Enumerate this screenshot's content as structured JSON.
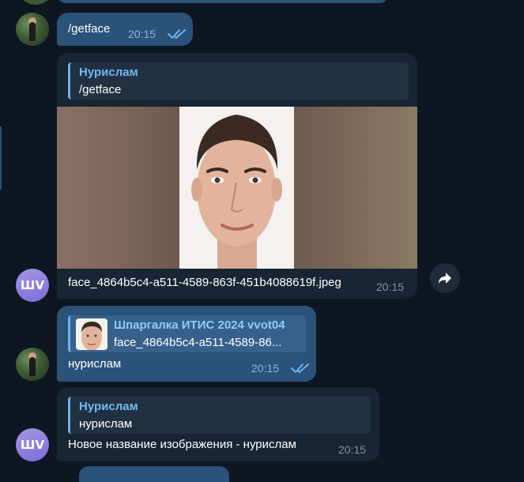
{
  "colors": {
    "background": "#0e1621",
    "bubble_outgoing": "#2b5278",
    "bubble_incoming": "#182533",
    "reply_accent": "#64b5ef",
    "reply_name": "#71baf2",
    "timestamp": "#7c93a8",
    "read_checks": "#6ab3f3",
    "avatar_initials_bg": "#8c7ae6"
  },
  "messages": [
    {
      "id": "m1",
      "direction": "outgoing",
      "avatar_icon": "user-photo-avatar",
      "text": "/getface",
      "time": "20:15",
      "status_icon": "double-check-icon"
    },
    {
      "id": "m2",
      "direction": "incoming",
      "avatar_initials": "ШV",
      "reply": {
        "name": "Нурислам",
        "text": "/getface"
      },
      "image_icon": "face-photo",
      "file_name": "face_4864b5c4-a511-4589-863f-451b4088619f.jpeg",
      "time": "20:15",
      "action_icon": "forward-arrow-icon"
    },
    {
      "id": "m3",
      "direction": "outgoing",
      "avatar_icon": "user-photo-avatar",
      "reply": {
        "name": "Шпаргалка ИТИС 2024 vvot04",
        "text": "face_4864b5c4-a511-4589-86..."
      },
      "text": "нурислам",
      "time": "20:15",
      "status_icon": "double-check-icon"
    },
    {
      "id": "m4",
      "direction": "incoming",
      "avatar_initials": "ШV",
      "reply": {
        "name": "Нурислам",
        "text": "нурислам"
      },
      "text": "Новое название изображения - нурислам",
      "time": "20:15"
    }
  ]
}
